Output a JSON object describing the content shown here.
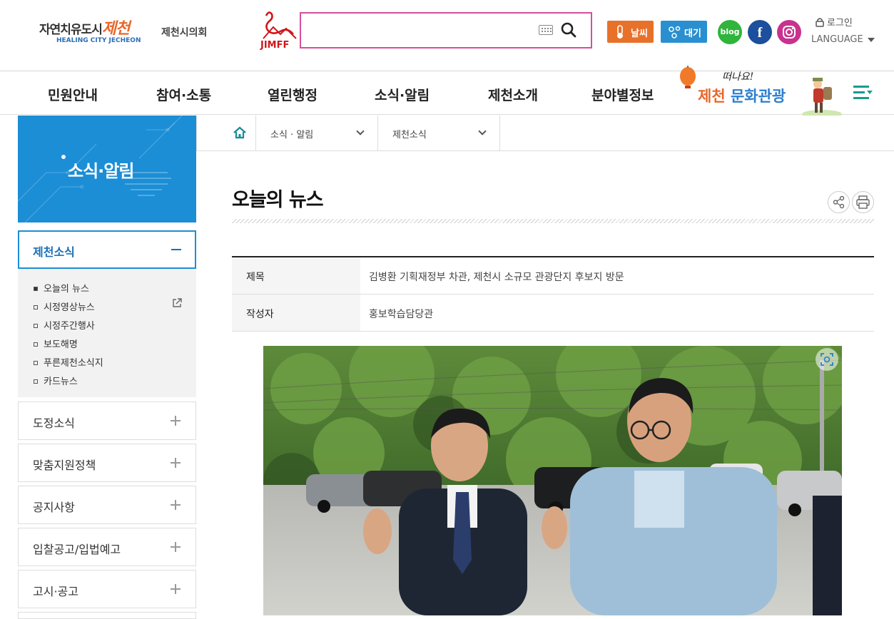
{
  "header": {
    "logo_main": "자연치유도시",
    "logo_brand": "제천",
    "logo_sub": "HEALING CITY JECHEON",
    "council_link": "제천시의회",
    "jimff_label": "JIMFF",
    "search_value": "",
    "weather_label": "날씨",
    "air_label": "대기",
    "blog_label": "blog",
    "facebook_label": "f",
    "login_label": "로그인",
    "language_label": "LANGUAGE"
  },
  "gnb": {
    "items": [
      "민원안내",
      "참여·소통",
      "열린행정",
      "소식·알림",
      "제천소개",
      "분야별정보"
    ],
    "tour_banner_line1": "떠나요!",
    "tour_banner_line2a": "제천",
    "tour_banner_line2b": "문화관광"
  },
  "sidebar": {
    "banner_title": "소식·알림",
    "open_section": "제천소식",
    "sub_items": [
      {
        "label": "오늘의 뉴스",
        "active": true
      },
      {
        "label": "시정영상뉴스",
        "active": false
      },
      {
        "label": "시정주간행사",
        "active": false
      },
      {
        "label": "보도해명",
        "active": false
      },
      {
        "label": "푸른제천소식지",
        "active": false
      },
      {
        "label": "카드뉴스",
        "active": false
      }
    ],
    "sections": [
      "도정소식",
      "맞춤지원정책",
      "공지사항",
      "입찰공고/입법예고",
      "고시·공고"
    ]
  },
  "breadcrumb": {
    "level1": "소식 · 알림",
    "level2": "제천소식"
  },
  "content": {
    "page_title": "오늘의 뉴스",
    "rows": [
      {
        "label": "제목",
        "value": "김병환 기획재정부 차관, 제천시 소규모 관광단지 후보지 방문"
      },
      {
        "label": "작성자",
        "value": "홍보학습담당관"
      }
    ]
  },
  "colors": {
    "accent_blue": "#1b8ed6",
    "search_border": "#d64f9a",
    "weather_orange": "#e8712a",
    "air_blue": "#2a8fd0",
    "blog_green": "#2fb43c",
    "facebook_blue": "#1c4f9c",
    "instagram": "#c8328e"
  }
}
